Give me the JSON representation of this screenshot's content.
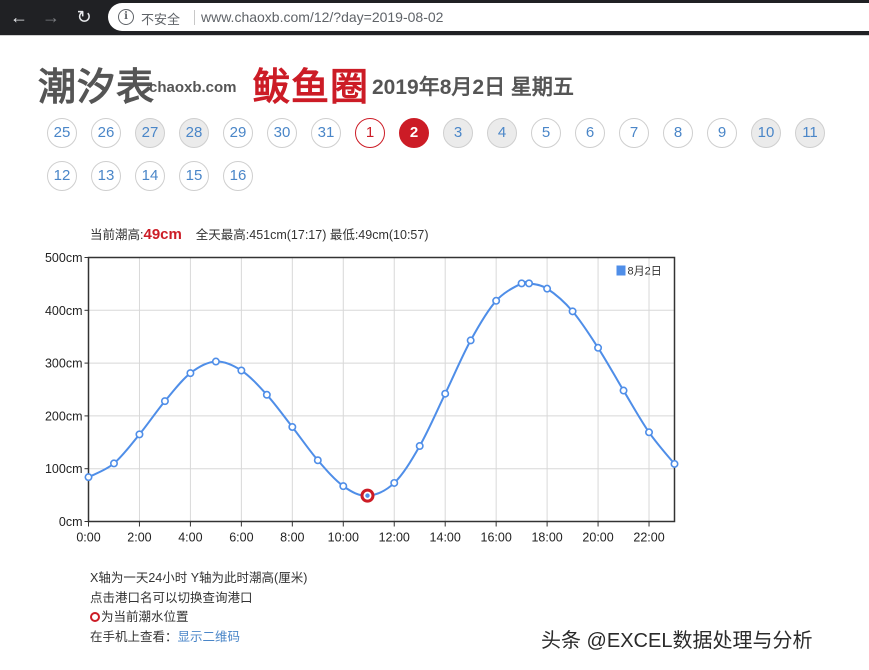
{
  "browser": {
    "back_icon": "arrow-left-icon",
    "forward_icon": "arrow-right-icon",
    "reload_icon": "reload-icon",
    "security_icon": "info-circle-icon",
    "security_label": "不安全",
    "url": "www.chaoxb.com/12/?day=2019-08-02"
  },
  "header": {
    "site_title": "潮汐表",
    "site_domain": "chaoxb.com",
    "brand_name": "鲅鱼圈",
    "date_text": "2019年8月2日 星期五"
  },
  "day_nav": [
    {
      "label": "25",
      "state": "normal"
    },
    {
      "label": "26",
      "state": "normal"
    },
    {
      "label": "27",
      "state": "shaded"
    },
    {
      "label": "28",
      "state": "shaded"
    },
    {
      "label": "29",
      "state": "normal"
    },
    {
      "label": "30",
      "state": "normal"
    },
    {
      "label": "31",
      "state": "normal"
    },
    {
      "label": "1",
      "state": "first"
    },
    {
      "label": "2",
      "state": "active"
    },
    {
      "label": "3",
      "state": "shaded"
    },
    {
      "label": "4",
      "state": "shaded"
    },
    {
      "label": "5",
      "state": "normal"
    },
    {
      "label": "6",
      "state": "normal"
    },
    {
      "label": "7",
      "state": "normal"
    },
    {
      "label": "8",
      "state": "normal"
    },
    {
      "label": "9",
      "state": "normal"
    },
    {
      "label": "10",
      "state": "shaded"
    },
    {
      "label": "11",
      "state": "shaded"
    },
    {
      "label": "12",
      "state": "normal"
    },
    {
      "label": "13",
      "state": "normal"
    },
    {
      "label": "14",
      "state": "normal"
    },
    {
      "label": "15",
      "state": "normal"
    },
    {
      "label": "16",
      "state": "normal"
    }
  ],
  "tide_info": {
    "current_label": "当前潮高:",
    "current_value": "49cm",
    "summary": "全天最高:451cm(17:17) 最低:49cm(10:57)"
  },
  "chart_data": {
    "type": "line",
    "title": "",
    "xlabel": "",
    "ylabel": "",
    "x_unit": "hour of day",
    "x_ticks": [
      "0:00",
      "2:00",
      "4:00",
      "6:00",
      "8:00",
      "10:00",
      "12:00",
      "14:00",
      "16:00",
      "18:00",
      "20:00",
      "22:00"
    ],
    "y_ticks": [
      "0cm",
      "100cm",
      "200cm",
      "300cm",
      "400cm",
      "500cm"
    ],
    "xlim": [
      0,
      23
    ],
    "ylim": [
      0,
      500
    ],
    "grid": true,
    "legend_position": "top-right",
    "series": [
      {
        "name": "8月2日",
        "color": "#4f8ee8",
        "points": [
          [
            0,
            84
          ],
          [
            1,
            110
          ],
          [
            2,
            165
          ],
          [
            3,
            228
          ],
          [
            4,
            281
          ],
          [
            5,
            303
          ],
          [
            6,
            286
          ],
          [
            7,
            240
          ],
          [
            8,
            179
          ],
          [
            9,
            116
          ],
          [
            10,
            67
          ],
          [
            10.95,
            49
          ],
          [
            12,
            73
          ],
          [
            13,
            143
          ],
          [
            14,
            242
          ],
          [
            15,
            343
          ],
          [
            16,
            418
          ],
          [
            17,
            451
          ],
          [
            17.29,
            451
          ],
          [
            18,
            441
          ],
          [
            19,
            398
          ],
          [
            20,
            329
          ],
          [
            21,
            248
          ],
          [
            22,
            169
          ],
          [
            23,
            109
          ]
        ]
      }
    ],
    "current_point": [
      10.95,
      49
    ],
    "current_marker_color": "#cc1c26"
  },
  "notes": {
    "line1": "X轴为一天24小时  Y轴为此时潮高(厘米)",
    "line2": "点击港口名可以切换查询港口",
    "line3_icon": "red-ring-icon",
    "line3": "为当前潮水位置",
    "line4_label": "在手机上查看：",
    "line4_link": "显示二维码"
  },
  "watermark": "头条 @EXCEL数据处理与分析"
}
